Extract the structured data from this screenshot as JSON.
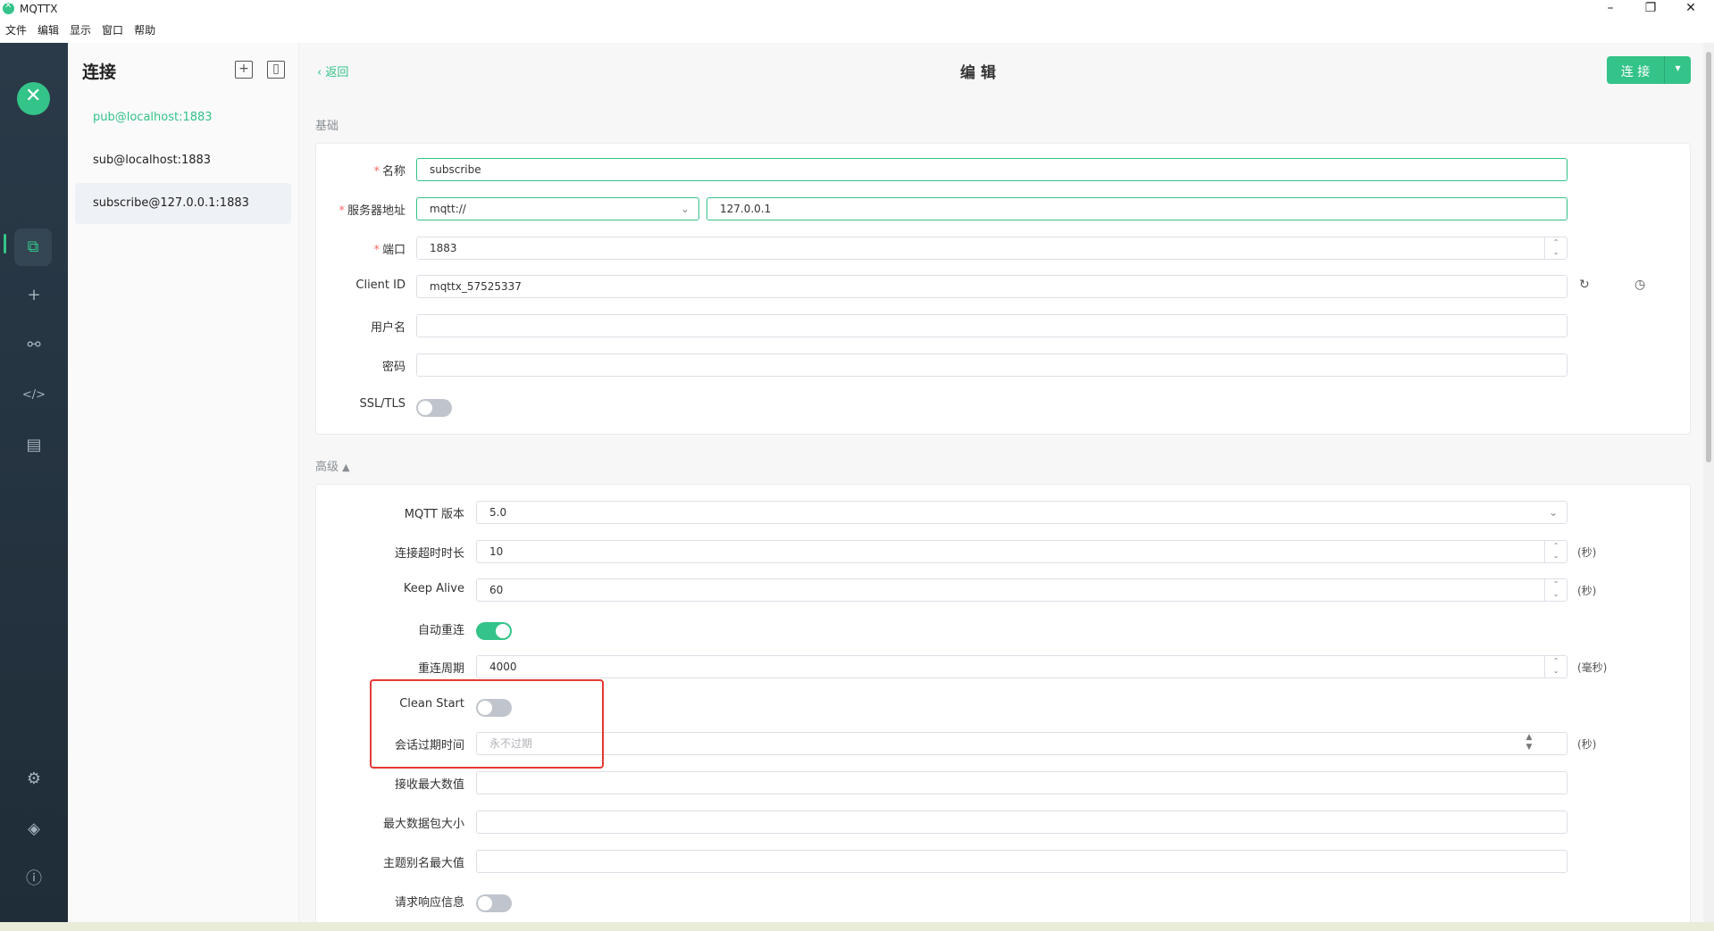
{
  "window": {
    "title": "MQTTX",
    "minimize": "–",
    "maximize": "❐",
    "close": "✕"
  },
  "menu": [
    "文件",
    "编辑",
    "显示",
    "窗口",
    "帮助"
  ],
  "sidebar": {
    "heading": "连接",
    "new_icon": "+",
    "connections": [
      {
        "name": "pub@localhost:1883",
        "state": "connected"
      },
      {
        "name": "sub@localhost:1883",
        "state": "idle"
      },
      {
        "name": "subscribe@127.0.0.1:1883",
        "state": "selected"
      }
    ]
  },
  "rail": {
    "icons": [
      "connections-icon",
      "add-icon",
      "topology-icon",
      "script-icon",
      "log-icon",
      "settings-icon",
      "feed-icon",
      "about-icon"
    ],
    "glyphs": [
      "⧉",
      "+",
      "⚯",
      "</>",
      "▤",
      "⚙",
      "◈",
      "ⓘ"
    ]
  },
  "header": {
    "back": "返回",
    "title": "编 辑",
    "connect": "连 接",
    "connect_dropdown": "▾"
  },
  "basic": {
    "section_title": "基础",
    "name_label": "名称",
    "name_value": "subscribe",
    "host_label": "服务器地址",
    "protocol_value": "mqtt://",
    "host_value": "127.0.0.1",
    "port_label": "端口",
    "port_value": "1883",
    "client_id_label": "Client ID",
    "client_id_value": "mqttx_57525337",
    "username_label": "用户名",
    "username_value": "",
    "password_label": "密码",
    "password_value": "",
    "ssl_label": "SSL/TLS",
    "ssl_on": false
  },
  "advanced": {
    "section_title": "高级",
    "mqtt_version_label": "MQTT 版本",
    "mqtt_version_value": "5.0",
    "connect_timeout_label": "连接超时时长",
    "connect_timeout_value": "10",
    "connect_timeout_unit": "(秒)",
    "keep_alive_label": "Keep Alive",
    "keep_alive_value": "60",
    "keep_alive_unit": "(秒)",
    "auto_reconnect_label": "自动重连",
    "auto_reconnect_on": true,
    "reconnect_period_label": "重连周期",
    "reconnect_period_value": "4000",
    "reconnect_period_unit": "(毫秒)",
    "clean_start_label": "Clean Start",
    "clean_start_on": false,
    "session_expiry_label": "会话过期时间",
    "session_expiry_placeholder": "永不过期",
    "session_expiry_unit": "(秒)",
    "receive_maximum_label": "接收最大数值",
    "max_packet_size_label": "最大数据包大小",
    "topic_alias_max_label": "主题别名最大值",
    "request_response_label": "请求响应信息",
    "request_response_on": false
  },
  "colors": {
    "accent": "#34c388",
    "highlight": "#e53935",
    "rail": "#2a3a48"
  }
}
